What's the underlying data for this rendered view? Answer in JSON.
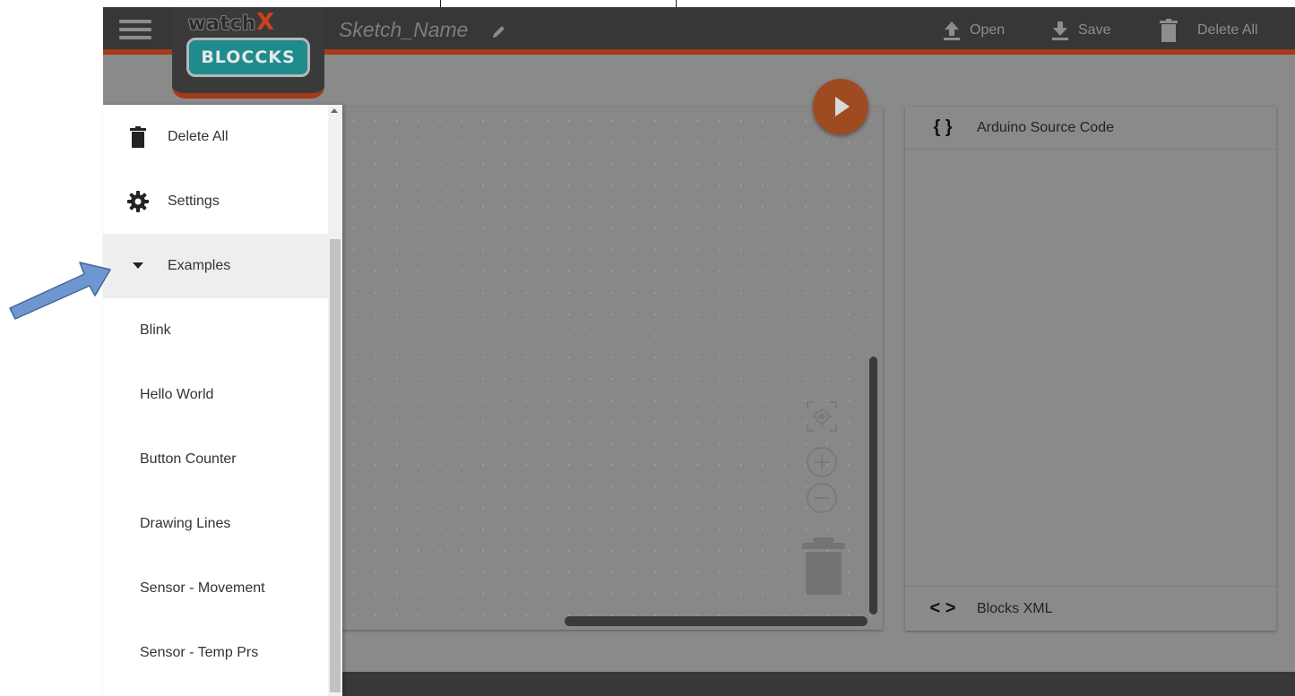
{
  "toolbar": {
    "sketch_name": "Sketch_Name",
    "open_label": "Open",
    "save_label": "Save",
    "delete_all_label": "Delete All"
  },
  "logo": {
    "top_text": "watch",
    "top_accent": "X",
    "bottom_text": "BLOCCKS"
  },
  "drawer": {
    "items": [
      {
        "label": "Delete All",
        "icon": "trash-icon"
      },
      {
        "label": "Settings",
        "icon": "gear-icon"
      },
      {
        "label": "Examples",
        "icon": "caret-down-icon"
      }
    ],
    "examples": [
      "Blink",
      "Hello World",
      "Button Counter",
      "Drawing Lines",
      "Sensor - Movement",
      "Sensor - Temp Prs"
    ]
  },
  "code_panel": {
    "arduino_symbol": "{ }",
    "arduino_label": "Arduino Source Code",
    "xml_symbol": "< >",
    "xml_label": "Blocks XML"
  },
  "colors": {
    "toolbar": "#373737",
    "accent": "#a53a1a",
    "run_button": "#a04a22",
    "logo_badge": "#1e8b8d",
    "annotation_arrow": "#6f97cf"
  }
}
